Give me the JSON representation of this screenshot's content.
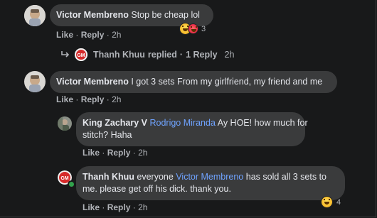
{
  "comments": [
    {
      "author": "Victor Membreno",
      "text": "Stop be cheap lol",
      "actions": {
        "like": "Like",
        "reply": "Reply",
        "time": "2h"
      },
      "reaction_count": "3"
    },
    {
      "author": "Victor Membreno",
      "text": "I got 3 sets From my girlfriend, my friend and me",
      "actions": {
        "like": "Like",
        "reply": "Reply",
        "time": "2h"
      }
    }
  ],
  "replied_summary": {
    "author": "Thanh Khuu",
    "replied": "replied",
    "dot": "·",
    "count": "1 Reply",
    "time": "2h"
  },
  "replies": [
    {
      "author": "King Zachary V",
      "mention": "Rodrigo Miranda",
      "text_line1": "Ay HOE! how much for",
      "text_line2": "stitch? Haha",
      "actions": {
        "like": "Like",
        "reply": "Reply",
        "time": "2h"
      }
    },
    {
      "author": "Thanh Khuu",
      "text_before": "everyone",
      "mention": "Victor Membreno",
      "text_after": "has sold all 3 sets to",
      "text_line2": "me. please get off his dick. thank you.",
      "actions": {
        "like": "Like",
        "reply": "Reply",
        "time": "2h"
      },
      "reaction_count": "4"
    }
  ],
  "separator": "·",
  "colors": {
    "background": "#18191a",
    "bubble": "#3a3b3c",
    "mention": "#6fa3ff",
    "meta": "#b0b3b8"
  },
  "icons": [
    "reply-arrow-icon",
    "haha-reaction-icon",
    "online-status-icon"
  ]
}
